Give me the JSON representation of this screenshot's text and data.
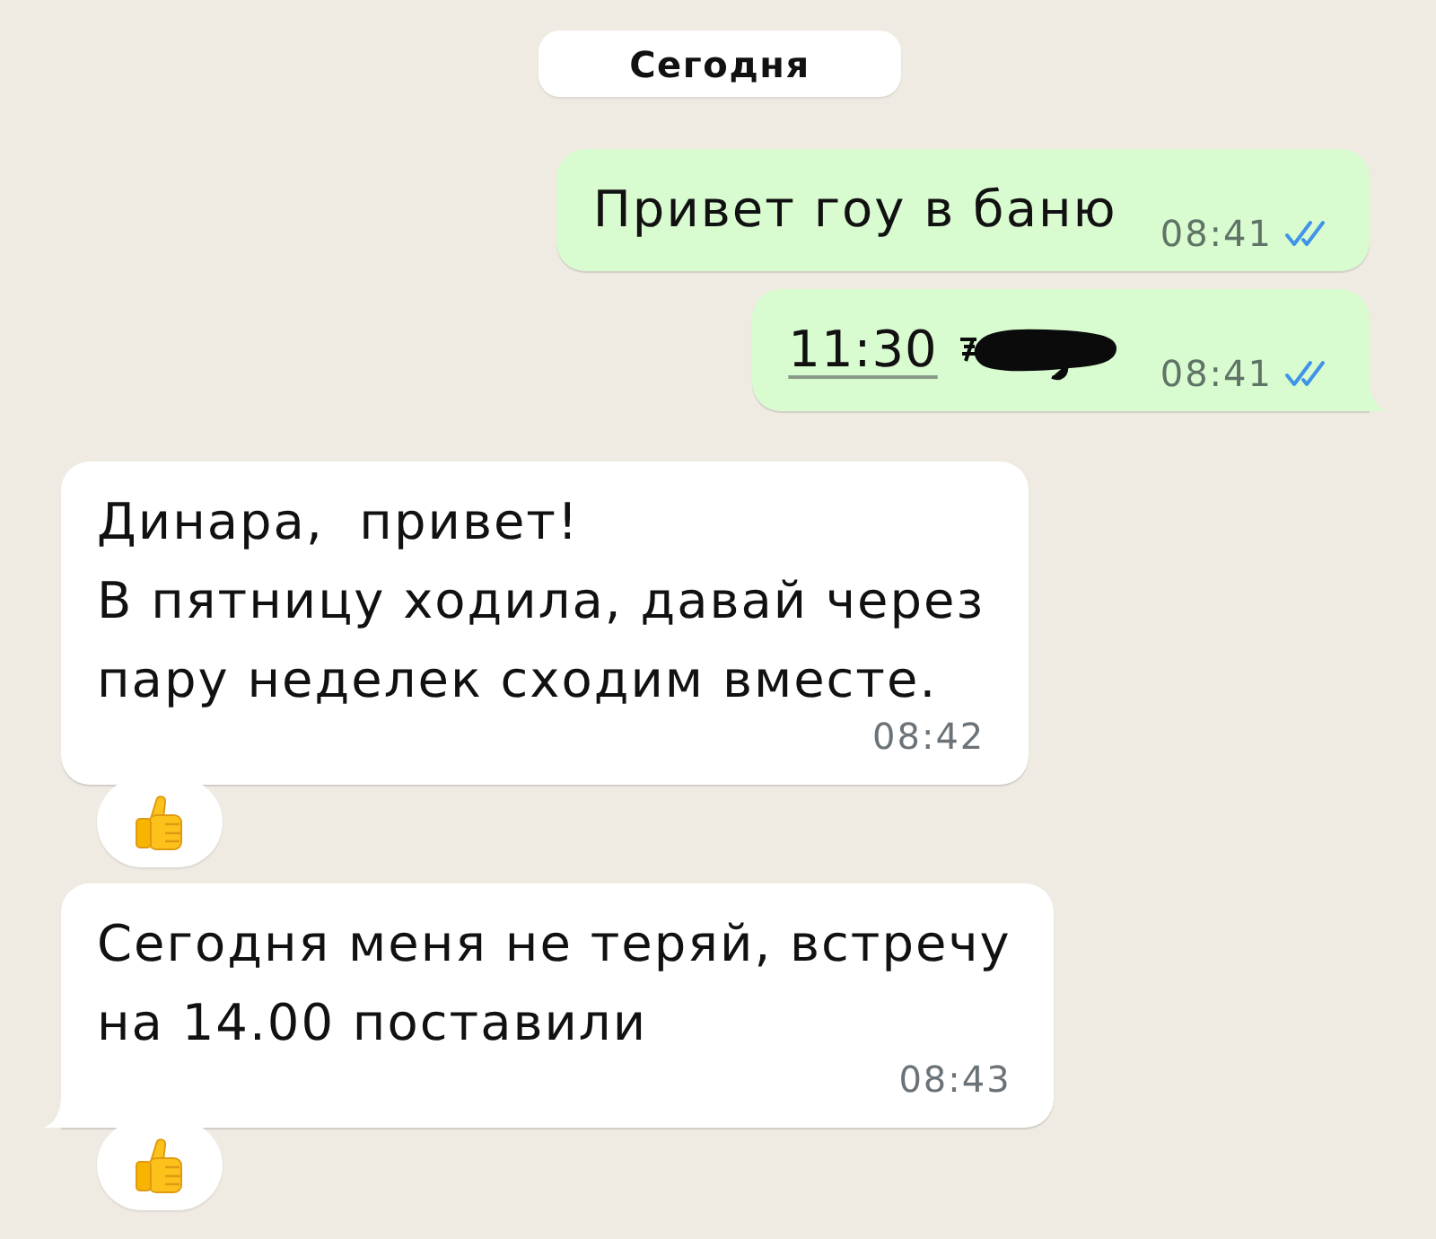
{
  "date_divider": {
    "label": "Сегодня"
  },
  "messages": [
    {
      "kind": "outgoing",
      "text": "Привет гоу в баню",
      "time": "08:41",
      "read": true,
      "tail": false,
      "redacted": false,
      "reaction": false
    },
    {
      "kind": "outgoing",
      "link": "11:30",
      "time": "08:41",
      "read": true,
      "tail": true,
      "redacted": true,
      "reaction": false
    },
    {
      "kind": "incoming",
      "text": "Динара,  привет!\nВ пятницу ходила, давай через\nпару неделек сходим вместе.",
      "time": "08:42",
      "tail": false,
      "redacted": false,
      "reaction": true
    },
    {
      "kind": "incoming",
      "text": "Сегодня меня не теряй, встречу\nна 14.00 поставили",
      "time": "08:43",
      "tail": true,
      "redacted": false,
      "reaction": true
    }
  ]
}
